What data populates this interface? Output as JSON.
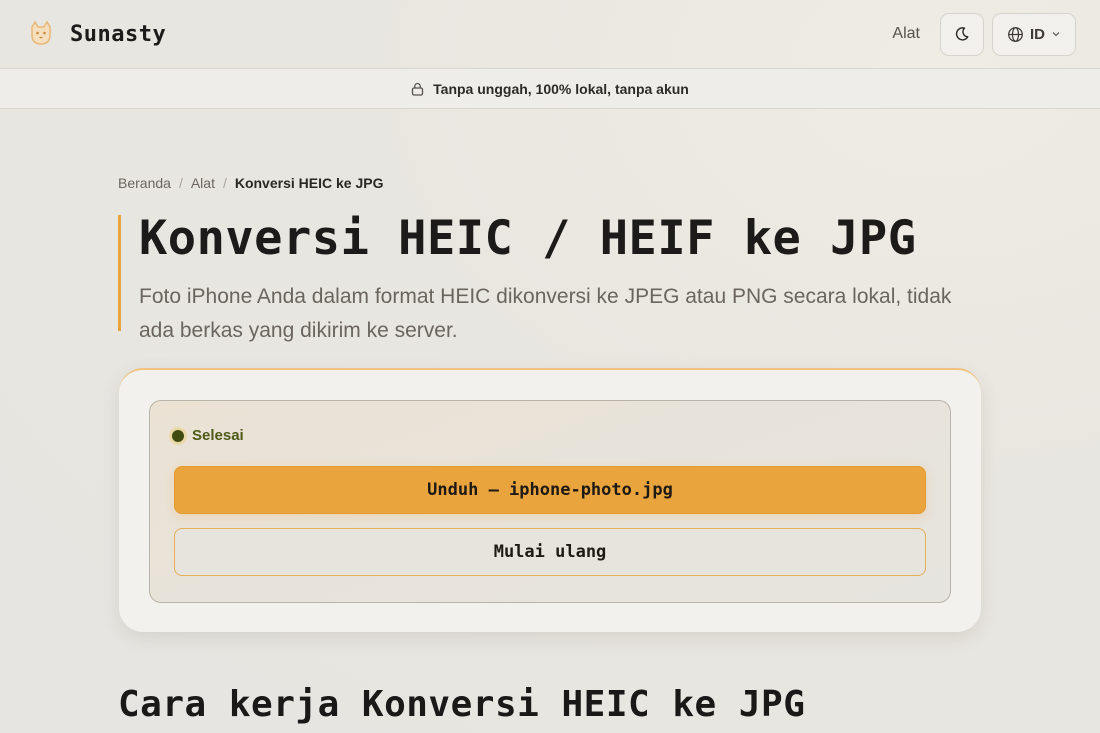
{
  "header": {
    "brand": "Sunasty",
    "nav_tools": "Alat",
    "language": "ID"
  },
  "notice": {
    "text": "Tanpa unggah, 100% lokal, tanpa akun"
  },
  "breadcrumb": {
    "home": "Beranda",
    "tools": "Alat",
    "current": "Konversi HEIC ke JPG",
    "separator": "/"
  },
  "hero": {
    "title": "Konversi HEIC / HEIF ke JPG",
    "subtitle": "Foto iPhone Anda dalam format HEIC dikonversi ke JPEG atau PNG secara lokal, tidak ada berkas yang dikirim ke server."
  },
  "tool": {
    "status": "Selesai",
    "download_label": "Unduh — iphone-photo.jpg",
    "restart_label": "Mulai ulang"
  },
  "section": {
    "how_it_works_title": "Cara kerja Konversi HEIC ke JPG"
  },
  "colors": {
    "accent": "#eaa43d",
    "status_dot": "#3f4b10",
    "status_text": "#4e5a17"
  },
  "icons": {
    "logo": "cat-logo-icon",
    "theme": "moon-icon",
    "language": "globe-icon",
    "language_caret": "chevron-down-icon",
    "notice": "lock-icon"
  }
}
